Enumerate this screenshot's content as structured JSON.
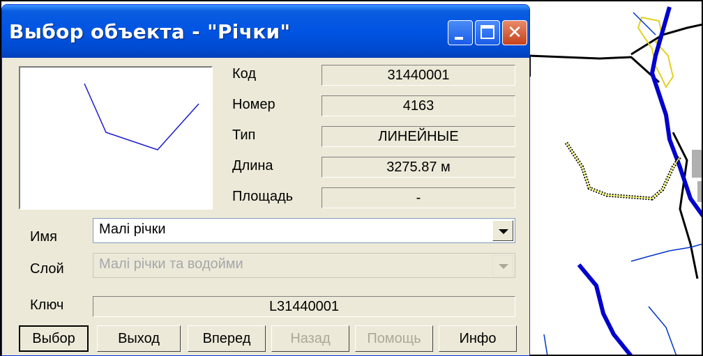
{
  "window": {
    "title": "Выбор объекта - \"Річки\"",
    "close_glyph": "✕"
  },
  "props": [
    {
      "label": "Код",
      "value": "31440001"
    },
    {
      "label": "Номер",
      "value": "4163"
    },
    {
      "label": "Тип",
      "value": "ЛИНЕЙНЫЕ"
    },
    {
      "label": "Длина",
      "value": "3275.87  м"
    },
    {
      "label": "Площадь",
      "value": "-"
    }
  ],
  "name_row": {
    "label": "Имя",
    "value": "Малі річки"
  },
  "layer_row": {
    "label": "Слой",
    "value": "Малі річки та водойми"
  },
  "key_row": {
    "label": "Ключ",
    "value": "L31440001"
  },
  "buttons": {
    "select": "Выбор",
    "exit": "Выход",
    "forward": "Вперед",
    "back": "Назад",
    "help": "Помощь",
    "info": "Инфо"
  },
  "icons": [
    "minimize-icon",
    "maximize-icon",
    "close-icon",
    "chevron-down-icon"
  ],
  "colors": {
    "titlebar": "#0054e3",
    "close_button": "#c4421b",
    "river": "#0000cc",
    "boundary": "#000000",
    "highlight": "#ffff66"
  }
}
